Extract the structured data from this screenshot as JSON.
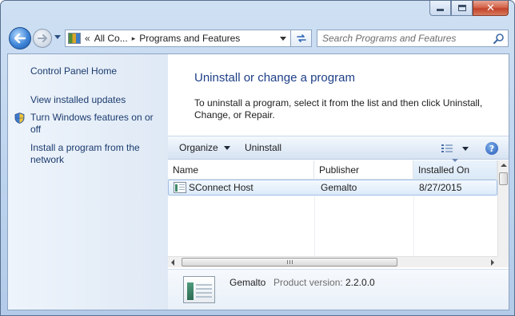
{
  "window": {
    "caption": {
      "minimize": "minimize",
      "maximize": "maximize",
      "close": "close"
    }
  },
  "nav": {
    "address": {
      "overflow": "«",
      "crumb1": "All Co...",
      "separator": "▸",
      "crumb2": "Programs and Features"
    },
    "search_placeholder": "Search Programs and Features"
  },
  "sidebar": {
    "items": [
      {
        "label": "Control Panel Home"
      },
      {
        "label": "View installed updates"
      },
      {
        "label": "Turn Windows features on or off"
      },
      {
        "label": "Install a program from the network"
      }
    ]
  },
  "main": {
    "title": "Uninstall or change a program",
    "description": "To uninstall a program, select it from the list and then click Uninstall, Change, or Repair."
  },
  "toolbar": {
    "organize_label": "Organize",
    "uninstall_label": "Uninstall",
    "help_label": "?"
  },
  "table": {
    "columns": [
      "Name",
      "Publisher",
      "Installed On"
    ],
    "sorted_column": "Installed On",
    "rows": [
      {
        "name": "SConnect Host",
        "publisher": "Gemalto",
        "installed_on": "8/27/2015",
        "selected": true
      }
    ]
  },
  "details": {
    "publisher": "Gemalto",
    "version_label": "Product version:",
    "version": "2.2.0.0"
  },
  "colors": {
    "link": "#1b3b6f",
    "title": "#1e3f87",
    "selection_border": "#9fbfe6"
  }
}
